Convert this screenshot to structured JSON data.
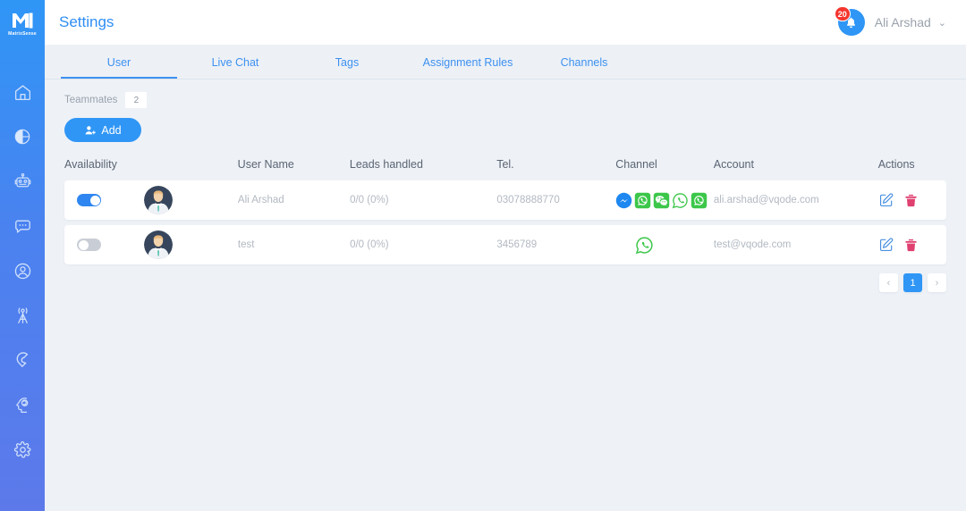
{
  "brand": {
    "name": "MatrixSense",
    "logo_icon": "matrixsense-logo"
  },
  "sidebar": {
    "items": [
      {
        "icon": "home-icon",
        "name": "home"
      },
      {
        "icon": "pie-chart-icon",
        "name": "analytics"
      },
      {
        "icon": "robot-icon",
        "name": "bots"
      },
      {
        "icon": "chat-icon",
        "name": "messages"
      },
      {
        "icon": "user-icon",
        "name": "contacts"
      },
      {
        "icon": "broadcast-icon",
        "name": "broadcast"
      },
      {
        "icon": "magnet-icon",
        "name": "leads"
      },
      {
        "icon": "brain-icon",
        "name": "ai"
      },
      {
        "icon": "gear-icon",
        "name": "settings"
      }
    ]
  },
  "header": {
    "title": "Settings",
    "notifications": {
      "icon": "bell-icon",
      "count": "20"
    },
    "user": {
      "name": "Ali Arshad",
      "caret": "⌄"
    }
  },
  "tabs": [
    {
      "label": "User",
      "active": true
    },
    {
      "label": "Live Chat",
      "active": false
    },
    {
      "label": "Tags",
      "active": false
    },
    {
      "label": "Assignment Rules",
      "active": false
    },
    {
      "label": "Channels",
      "active": false
    }
  ],
  "teammates": {
    "label": "Teammates",
    "count": "2",
    "add_label": "Add",
    "add_icon": "add-user-icon"
  },
  "table": {
    "columns": [
      "Availability",
      "User Name",
      "Leads handled",
      "Tel.",
      "Channel",
      "Account",
      "Actions"
    ],
    "rows": [
      {
        "available": true,
        "avatar": "user-avatar",
        "user_name": "Ali Arshad",
        "leads_handled": "0/0 (0%)",
        "tel": "03078888770",
        "channels": [
          "messenger",
          "whatsapp",
          "wechat",
          "whatsapp-outline",
          "whatsapp"
        ],
        "account": "ali.arshad@vqode.com",
        "actions": [
          "edit-icon",
          "delete-icon"
        ]
      },
      {
        "available": false,
        "avatar": "user-avatar",
        "user_name": "test",
        "leads_handled": "0/0 (0%)",
        "tel": "3456789",
        "channels": [
          "whatsapp-outline"
        ],
        "account": "test@vqode.com",
        "actions": [
          "edit-icon",
          "delete-icon"
        ]
      }
    ]
  },
  "pagination": {
    "prev": "‹",
    "pages": [
      "1"
    ],
    "next": "›",
    "current": "1"
  },
  "colors": {
    "accent": "#2f96f6",
    "sidebar_top": "#2f96f6",
    "sidebar_bottom": "#5d79ea",
    "background": "#eef2f7",
    "whatsapp_green": "#3cc74a",
    "messenger_blue": "#1e88f0",
    "delete_pink": "#e04070",
    "badge_red": "#f4352e"
  }
}
